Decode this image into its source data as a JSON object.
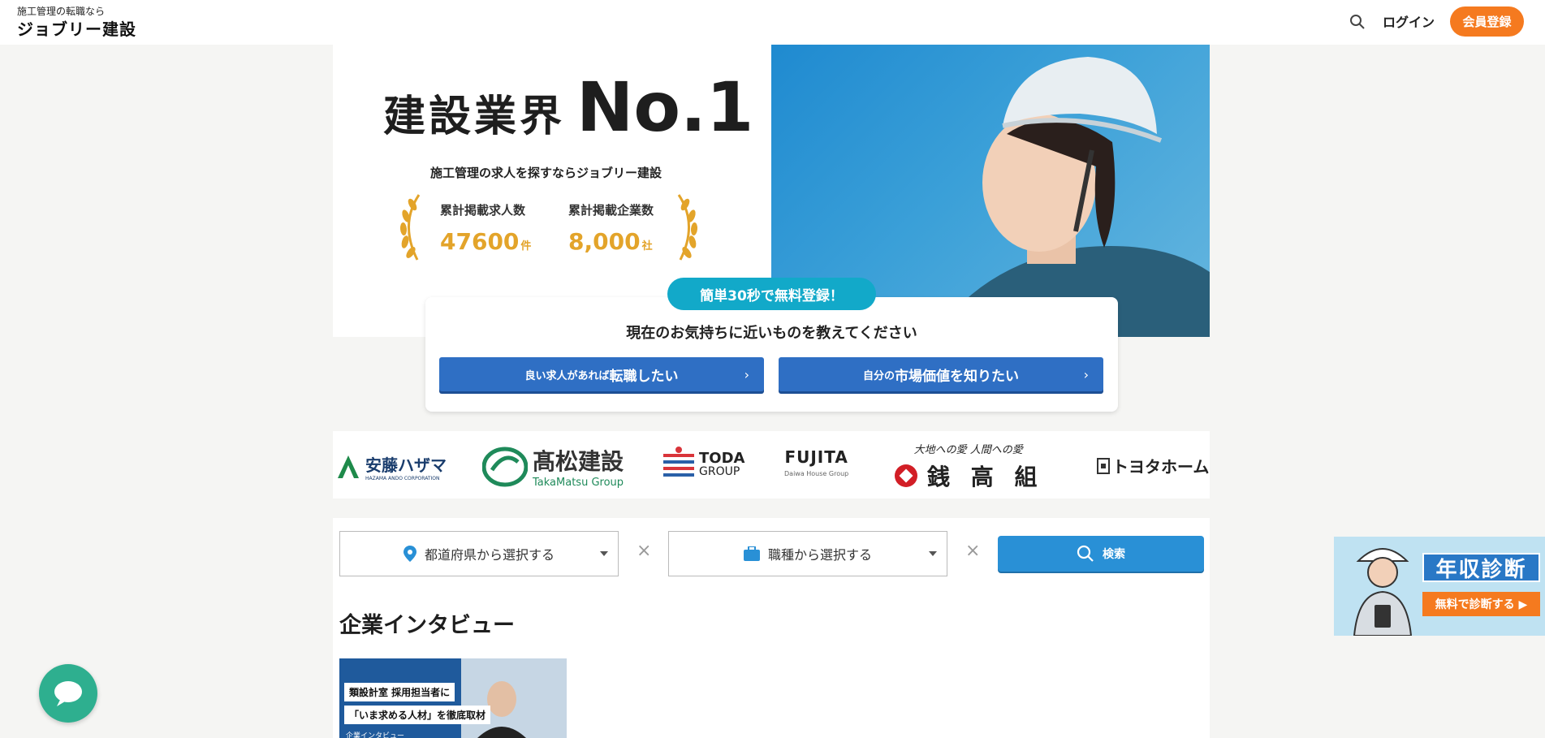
{
  "header": {
    "tagline": "施工管理の転職なら",
    "brand": "ジョブリー建設",
    "login_label": "ログイン",
    "register_label": "会員登録"
  },
  "hero": {
    "title_text": "建設業界",
    "title_rank": "No.1",
    "subtitle": "施工管理の求人を探すならジョブリー建設",
    "stats": [
      {
        "label": "累計掲載求人数",
        "value": "47600",
        "unit": "件"
      },
      {
        "label": "累計掲載企業数",
        "value": "8,000",
        "unit": "社"
      }
    ]
  },
  "cta": {
    "badge": "簡単30秒で無料登録！",
    "question": "現在のお気持ちに近いものを教えてください",
    "btn1_small": "良い求人があれば",
    "btn1_big": "転職したい",
    "btn2_small": "自分の",
    "btn2_big": "市場価値を知りたい"
  },
  "company_logos": [
    {
      "name": "安藤ハザマ",
      "sub": "HAZAMA ANDO CORPORATION"
    },
    {
      "name": "髙松建設",
      "sub": "TakaMatsu Group"
    },
    {
      "name": "TODA",
      "sub": "GROUP"
    },
    {
      "name": "FUJITA",
      "sub": "Daiwa House Group"
    },
    {
      "name": "銭 高 組",
      "sub": "大地への愛 人間への愛"
    },
    {
      "name": "トヨタホーム",
      "sub": ""
    }
  ],
  "search": {
    "prefecture_placeholder": "都道府県から選択する",
    "job_placeholder": "職種から選択する",
    "clear_symbol": "×",
    "search_label": "検索"
  },
  "interviews": {
    "title": "企業インタビュー",
    "card_line1": "類設計室 採用担当者に",
    "card_line2": "「いま求める人材」を徹底取材",
    "card_line3": "企業インタビュー"
  },
  "side_banner": {
    "title": "年収診断",
    "button": "無料で診断する ▶"
  },
  "colors": {
    "accent_orange": "#f57a1f",
    "cta_blue": "#2f6fc4",
    "search_blue": "#2990d6",
    "badge_teal": "#12a9c9",
    "gold": "#e3a42a",
    "chat_green": "#2eaf8f"
  }
}
